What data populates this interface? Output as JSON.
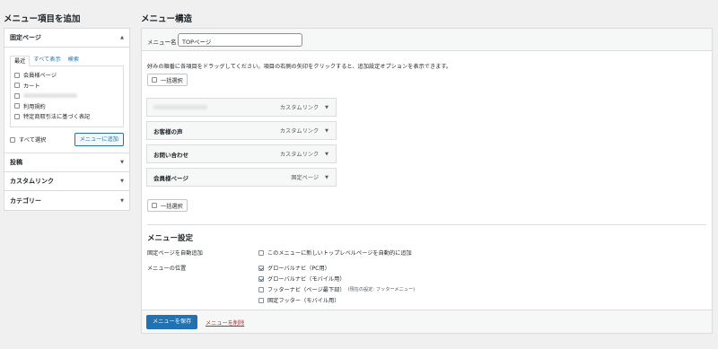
{
  "left": {
    "heading": "メニュー項目を追加",
    "pages_section": "固定ページ",
    "tabs": [
      "最近",
      "すべて表示",
      "検索"
    ],
    "pages": [
      {
        "label": "会員様ページ",
        "blurred": false
      },
      {
        "label": "カート",
        "blurred": false
      },
      {
        "label": "",
        "blurred": true
      },
      {
        "label": "利用規約",
        "blurred": false
      },
      {
        "label": "特定商取引法に基づく表記",
        "blurred": false
      }
    ],
    "select_all": "すべて選択",
    "add_button": "メニューに追加",
    "posts_section": "投稿",
    "custom_links_section": "カスタムリンク",
    "categories_section": "カテゴリー"
  },
  "main": {
    "heading": "メニュー構造",
    "menu_name_label": "メニュー名",
    "menu_name_value": "TOPページ",
    "instruction": "好みの順番に各項目をドラッグしてください。項目の右側の矢印をクリックすると、追加設定オプションを表示できます。",
    "bulk_select": "一括選択",
    "items": [
      {
        "title": "",
        "type": "カスタムリンク",
        "blurred": true
      },
      {
        "title": "お客様の声",
        "type": "カスタムリンク",
        "blurred": false
      },
      {
        "title": "お問い合わせ",
        "type": "カスタムリンク",
        "blurred": false
      },
      {
        "title": "会員様ページ",
        "type": "固定ページ",
        "blurred": false
      }
    ],
    "settings_title": "メニュー設定",
    "auto_add_label": "固定ページを自動追加",
    "auto_add_option": "このメニューに新しいトップレベルページを自動的に追加",
    "location_label": "メニューの位置",
    "locations": [
      {
        "label": "グローバルナビ（PC用）",
        "checked": true,
        "note": ""
      },
      {
        "label": "グローバルナビ（モバイル用）",
        "checked": true,
        "note": ""
      },
      {
        "label": "フッターナビ（ページ最下部）",
        "checked": false,
        "note": "(現在の設定: フッターメニュー)"
      },
      {
        "label": "固定フッター（モバイル用）",
        "checked": false,
        "note": ""
      }
    ],
    "save_button": "メニューを保存",
    "delete_link": "メニューを削除"
  },
  "colors": {
    "primary": "#2271b1",
    "danger": "#b32d2e",
    "background": "#f0f0f1"
  }
}
